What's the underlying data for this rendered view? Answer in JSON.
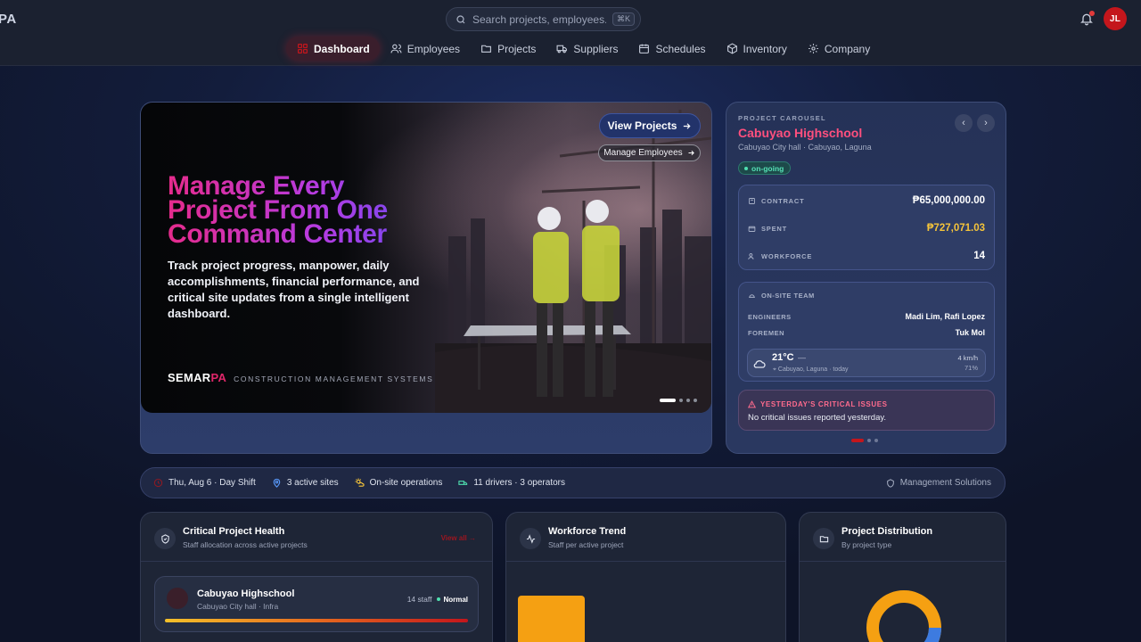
{
  "app": {
    "brand_fragment": "PA"
  },
  "search": {
    "placeholder": "Search projects, employees...",
    "shortcut": "⌘K"
  },
  "user": {
    "initials": "JL"
  },
  "nav": [
    {
      "label": "Dashboard",
      "icon": "dashboard-icon",
      "active": true
    },
    {
      "label": "Employees",
      "icon": "users-icon"
    },
    {
      "label": "Projects",
      "icon": "folder-icon"
    },
    {
      "label": "Suppliers",
      "icon": "truck-icon"
    },
    {
      "label": "Schedules",
      "icon": "calendar-icon"
    },
    {
      "label": "Inventory",
      "icon": "box-icon"
    },
    {
      "label": "Company",
      "icon": "gear-icon"
    }
  ],
  "hero": {
    "title": "Manage Every Project From One Command Center",
    "description": "Track project progress, manpower, daily accomplishments, financial performance, and critical site updates from a single intelligent dashboard.",
    "brand_main": "SEMAR",
    "brand_accent": "PA",
    "tagline": "CONSTRUCTION MANAGEMENT SYSTEMS",
    "view_button": "View Projects",
    "manage_button": "Manage Employees",
    "slide_count": 4,
    "active_slide": 1
  },
  "carousel": {
    "kicker": "PROJECT CAROUSEL",
    "project_name": "Cabuyao Highschool",
    "location": "Cabuyao City hall · Cabuyao, Laguna",
    "status": "on-going",
    "contract_label": "CONTRACT",
    "contract_value": "₱65,000,000.00",
    "spent_label": "SPENT",
    "spent_value": "₱727,071.03",
    "workforce_label": "WORKFORCE",
    "workforce_value": "14",
    "team_label": "ON-SITE TEAM",
    "engineers_label": "ENGINEERS",
    "engineers_value": "Madi Lim, Rafi Lopez",
    "foremen_label": "FOREMEN",
    "foremen_value": "Tuk Mol",
    "weather_temp": "21°C",
    "weather_dash": "—",
    "weather_place": "Cabuyao, Laguna · today",
    "weather_wind": "4 km/h",
    "weather_humidity": "71%",
    "issues_title": "YESTERDAY'S CRITICAL ISSUES",
    "issues_text": "No critical issues reported yesterday.",
    "slide_count": 3,
    "active_slide": 1
  },
  "strip": {
    "date": "Thu, Aug 6 · Day Shift",
    "sites": "3 active sites",
    "operations": "On-site operations",
    "fleet": "11 drivers · 3 operators",
    "right": "Management Solutions"
  },
  "cards": {
    "health": {
      "title": "Critical Project Health",
      "subtitle": "Staff allocation across active projects",
      "view_all": "View all",
      "project_name": "Cabuyao Highschool",
      "project_sub": "Cabuyao City hall · Infra",
      "staff": "14 staff",
      "status": "Normal"
    },
    "trend": {
      "title": "Workforce Trend",
      "subtitle": "Staff per active project"
    },
    "distribution": {
      "title": "Project Distribution",
      "subtitle": "By project type"
    }
  },
  "colors": {
    "accent": "#c4161c",
    "brand_pink": "#e0266a",
    "gold": "#f5c43a",
    "teal": "#4fe0b0",
    "chart_orange": "#f5a012",
    "chart_blue": "#3d7be0"
  }
}
